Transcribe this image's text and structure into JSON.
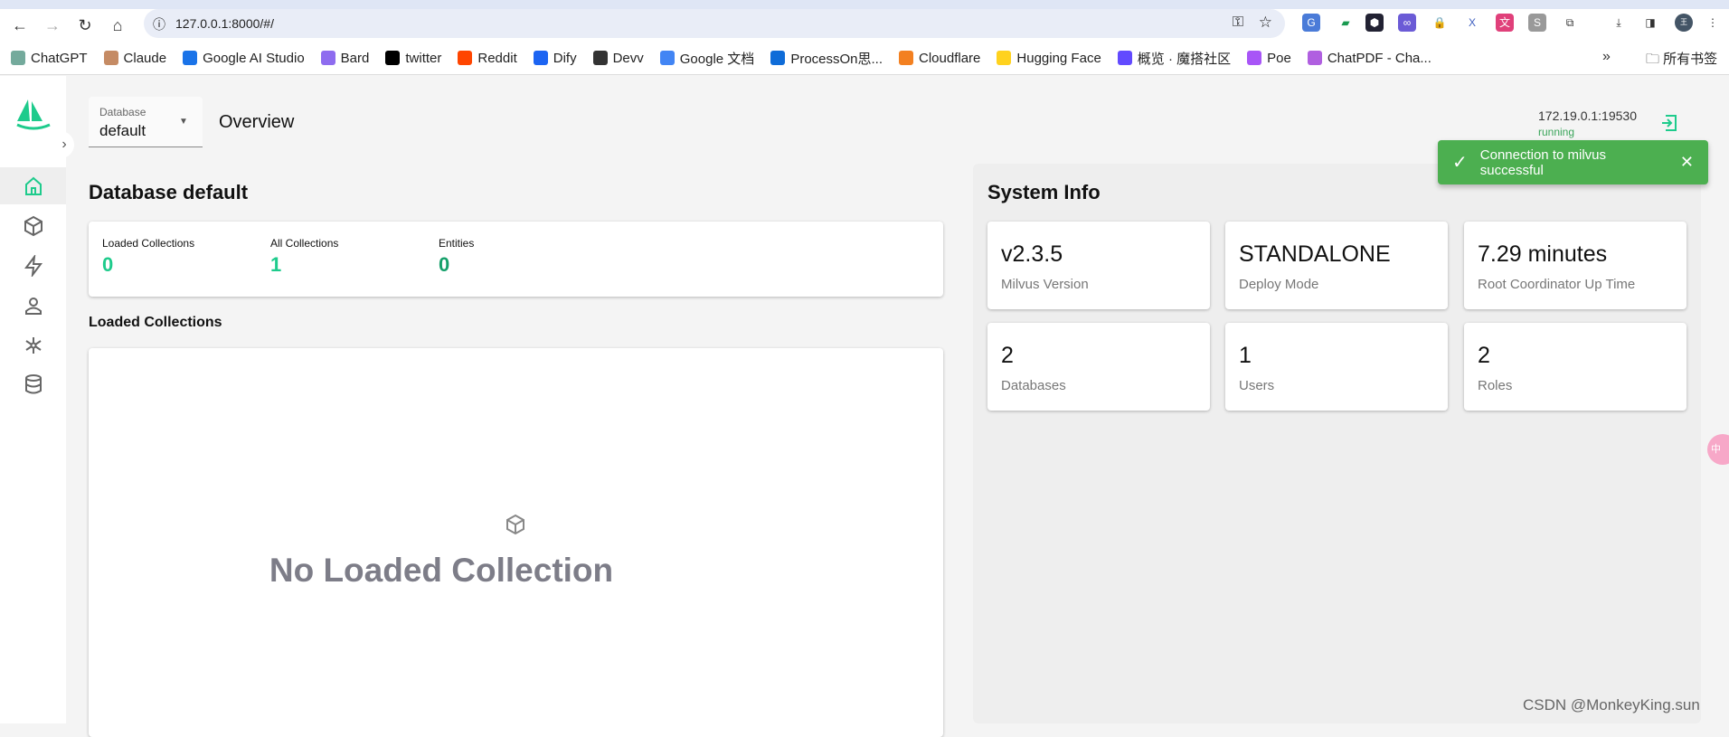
{
  "browser": {
    "url": "127.0.0.1:8000/#/",
    "bookmarks": [
      {
        "label": "ChatGPT",
        "color": "#74aa9c"
      },
      {
        "label": "Claude",
        "color": "#c58b64"
      },
      {
        "label": "Google AI Studio",
        "color": "#1a73e8"
      },
      {
        "label": "Bard",
        "color": "#8e6cef"
      },
      {
        "label": "twitter",
        "color": "#000000"
      },
      {
        "label": "Reddit",
        "color": "#ff4500"
      },
      {
        "label": "Dify",
        "color": "#1c64f2"
      },
      {
        "label": "Devv",
        "color": "#333333"
      },
      {
        "label": "Google 文档",
        "color": "#4285f4"
      },
      {
        "label": "ProcessOn思...",
        "color": "#0f6cd8"
      },
      {
        "label": "Cloudflare",
        "color": "#f38020"
      },
      {
        "label": "Hugging Face",
        "color": "#ffd21e"
      },
      {
        "label": "概览 · 魔搭社区",
        "color": "#624aff"
      },
      {
        "label": "Poe",
        "color": "#a855f7"
      },
      {
        "label": "ChatPDF - Cha...",
        "color": "#b05fe0"
      }
    ],
    "more": "»",
    "all_bookmarks": "所有书签"
  },
  "header": {
    "db_label": "Database",
    "db_value": "default",
    "page_title": "Overview",
    "address": "172.19.0.1:19530",
    "status": "running"
  },
  "toast": {
    "message": "Connection to milvus successful"
  },
  "main": {
    "title": "Database default",
    "stats": [
      {
        "label": "Loaded Collections",
        "value": "0"
      },
      {
        "label": "All Collections",
        "value": "1"
      },
      {
        "label": "Entities",
        "value": "0"
      }
    ],
    "loaded_title": "Loaded Collections",
    "empty_text": "No Loaded Collection"
  },
  "system": {
    "title": "System Info",
    "cards": [
      {
        "value": "v2.3.5",
        "label": "Milvus Version"
      },
      {
        "value": "STANDALONE",
        "label": "Deploy Mode"
      },
      {
        "value": "7.29 minutes",
        "label": "Root Coordinator Up Time"
      },
      {
        "value": "2",
        "label": "Databases"
      },
      {
        "value": "1",
        "label": "Users"
      },
      {
        "value": "2",
        "label": "Roles"
      }
    ]
  },
  "watermark": "CSDN @MonkeyKing.sun",
  "colors": {
    "accent": "#1ecb8c",
    "toast": "#4caf50"
  }
}
